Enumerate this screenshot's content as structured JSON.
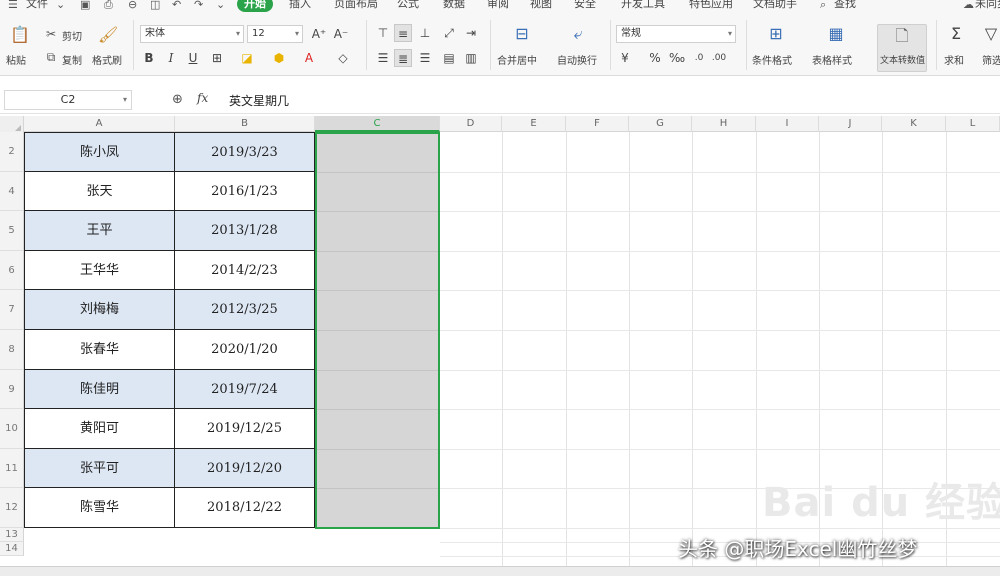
{
  "menubar": {
    "file": "文件",
    "tabs": [
      "开始",
      "插入",
      "页面布局",
      "公式",
      "数据",
      "审阅",
      "视图",
      "安全",
      "开发工具",
      "特色应用",
      "文档助手"
    ],
    "active_tab": "开始",
    "search": "查找",
    "right": "未同步"
  },
  "ribbon": {
    "paste": "粘贴",
    "cut": "剪切",
    "copy": "复制",
    "format_painter": "格式刷",
    "font_name": "宋体",
    "font_size": "12",
    "merge_center": "合并居中",
    "auto_wrap": "自动换行",
    "number_format": "常规",
    "cond_format": "条件格式",
    "table_style": "表格样式",
    "text_to_number": "文本转数值",
    "sum": "求和",
    "filter": "筛选"
  },
  "formulabar": {
    "name_box": "C2",
    "fx": "fx",
    "formula": "英文星期几"
  },
  "columns": [
    "A",
    "B",
    "C",
    "D",
    "E",
    "F",
    "G",
    "H",
    "I",
    "J",
    "K",
    "L"
  ],
  "selected_column": "C",
  "row_numbers": [
    "2",
    "4",
    "5",
    "6",
    "7",
    "8",
    "9",
    "10",
    "11",
    "12",
    "13",
    "14"
  ],
  "rows": [
    {
      "name": "陈小凤",
      "date": "2019/3/23"
    },
    {
      "name": "张天",
      "date": "2016/1/23"
    },
    {
      "name": "王平",
      "date": "2013/1/28"
    },
    {
      "name": "王华华",
      "date": "2014/2/23"
    },
    {
      "name": "刘梅梅",
      "date": "2012/3/25"
    },
    {
      "name": "张春华",
      "date": "2020/1/20"
    },
    {
      "name": "陈佳明",
      "date": "2019/7/24"
    },
    {
      "name": "黄阳可",
      "date": "2019/12/25"
    },
    {
      "name": "张平可",
      "date": "2019/12/20"
    },
    {
      "name": "陈雪华",
      "date": "2018/12/22"
    }
  ],
  "watermark": "头条 @职场Excel幽竹丝梦",
  "baidu_logo": "Bai du 经验"
}
